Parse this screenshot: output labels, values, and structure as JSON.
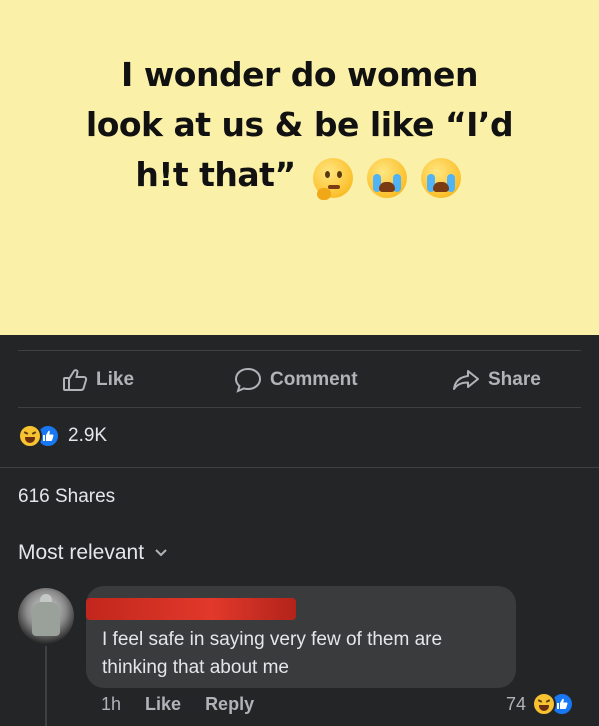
{
  "post": {
    "text_line1": "I wonder do women",
    "text_line2": "look at us & be like “I’d",
    "text_line3": "h!t that”",
    "emojis": [
      "thinking-face-icon",
      "loudly-crying-face-icon",
      "loudly-crying-face-icon"
    ],
    "background_color": "#fbf0a8"
  },
  "actions": {
    "like_label": "Like",
    "comment_label": "Comment",
    "share_label": "Share"
  },
  "stats": {
    "reaction_icons": [
      "haha-reaction-icon",
      "like-reaction-icon"
    ],
    "reaction_count": "2.9K",
    "shares_label": "616 Shares"
  },
  "comments_filter": {
    "label": "Most relevant"
  },
  "comment": {
    "text": "I feel safe in saying very few of them are thinking that about me",
    "time": "1h",
    "like_label": "Like",
    "reply_label": "Reply",
    "reaction_count": "74"
  },
  "colors": {
    "dark_background": "#242526",
    "bubble": "#3a3b3c",
    "like_blue": "#1877f2",
    "haha_yellow": "#f7c331",
    "redaction_red": "#d8302a"
  }
}
